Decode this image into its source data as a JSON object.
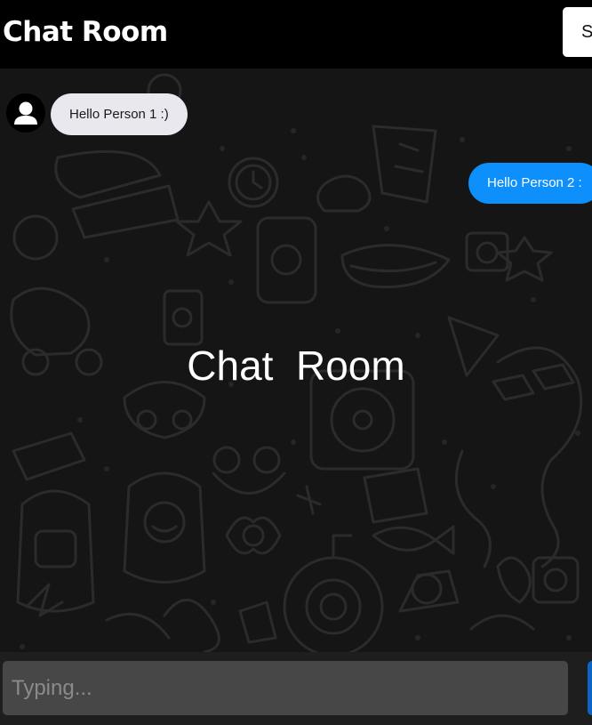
{
  "header": {
    "title": "Chat Room",
    "action_label": "S"
  },
  "chat": {
    "messages": [
      {
        "sender": "received",
        "text": "Hello Person 1 :)"
      },
      {
        "sender": "sent",
        "text": "Hello Person 2 :"
      }
    ],
    "watermark": "Chat  Room"
  },
  "composer": {
    "placeholder": "Typing...",
    "value": ""
  },
  "icons": {
    "avatar": "user-avatar-icon"
  },
  "colors": {
    "header_bg": "#000000",
    "received_bubble": "#e9e8ee",
    "sent_bubble": "#0d8ffc",
    "input_bg": "#474747",
    "send_button": "#0b66c3"
  }
}
